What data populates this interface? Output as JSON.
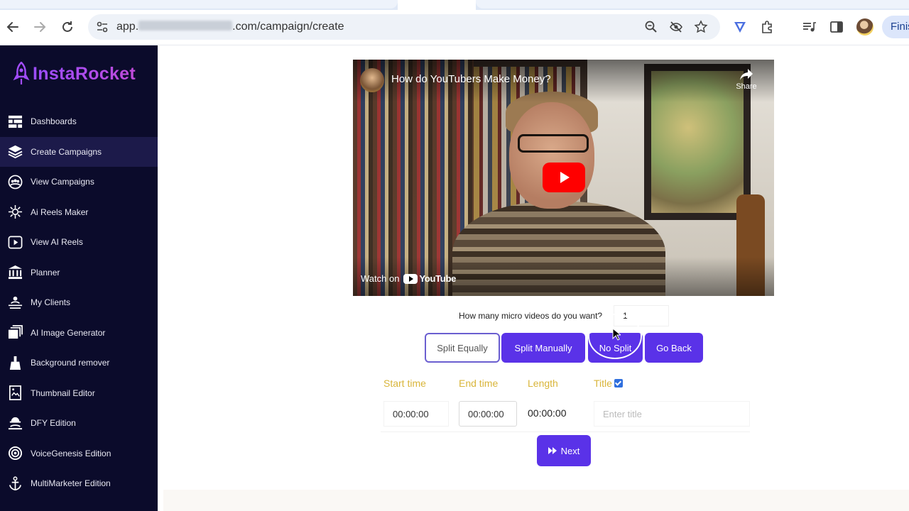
{
  "browser": {
    "url_prefix": "app.",
    "url_suffix": ".com/campaign/create",
    "profile_button_label": "Finis"
  },
  "sidebar": {
    "logo_text": "InstaRocket",
    "items": [
      {
        "label": "Dashboards",
        "icon": "dashboard-icon",
        "active": false
      },
      {
        "label": "Create Campaigns",
        "icon": "layers-icon",
        "active": true
      },
      {
        "label": "View Campaigns",
        "icon": "group-icon",
        "active": false
      },
      {
        "label": "Ai Reels Maker",
        "icon": "ai-chip-icon",
        "active": false
      },
      {
        "label": "View AI Reels",
        "icon": "play-square-icon",
        "active": false
      },
      {
        "label": "Planner",
        "icon": "bank-icon",
        "active": false
      },
      {
        "label": "My Clients",
        "icon": "clients-icon",
        "active": false
      },
      {
        "label": "AI Image Generator",
        "icon": "images-icon",
        "active": false
      },
      {
        "label": "Background remover",
        "icon": "broom-icon",
        "active": false
      },
      {
        "label": "Thumbnail Editor",
        "icon": "thumbnail-icon",
        "active": false
      },
      {
        "label": "DFY Edition",
        "icon": "worker-icon",
        "active": false
      },
      {
        "label": "VoiceGenesis Edition",
        "icon": "target-icon",
        "active": false
      },
      {
        "label": "MultiMarketer Edition",
        "icon": "anchor-icon",
        "active": false
      }
    ]
  },
  "video": {
    "title": "How do YouTubers Make Money?",
    "share_label": "Share",
    "watch_on": "Watch on",
    "youtube_label": "YouTube"
  },
  "split": {
    "question": "How many micro videos do you want?",
    "count_value": "1",
    "buttons": {
      "split_equally": "Split Equally",
      "split_manually": "Split Manually",
      "no_split": "No Split",
      "go_back": "Go Back"
    }
  },
  "segments": {
    "headers": {
      "start_time": "Start time",
      "end_time": "End time",
      "length": "Length",
      "title": "Title"
    },
    "title_checked": true,
    "row": {
      "start_time": "00:00:00",
      "end_time": "00:00:00",
      "length": "00:00:00",
      "title_placeholder": "Enter title"
    }
  },
  "next_button": "Next",
  "colors": {
    "sidebar_bg": "#0b0b2b",
    "accent_purple": "#5a32e8",
    "header_gold": "#d9b53a",
    "logo_gradient_start": "#9b4dff"
  }
}
